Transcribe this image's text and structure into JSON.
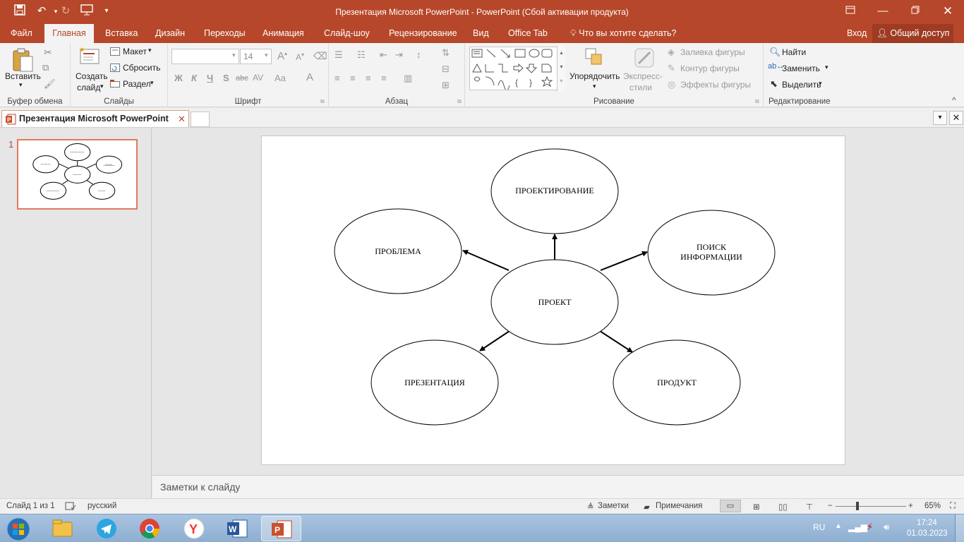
{
  "window": {
    "title": "Презентация Microsoft PowerPoint - PowerPoint (Сбой активации продукта)",
    "sign_in": "Вход",
    "share": "Общий доступ"
  },
  "tabs": [
    "Файл",
    "Главная",
    "Вставка",
    "Дизайн",
    "Переходы",
    "Анимация",
    "Слайд-шоу",
    "Рецензирование",
    "Вид",
    "Office Tab"
  ],
  "tell_me": "Что вы хотите сделать?",
  "ribbon": {
    "clipboard": {
      "paste": "Вставить",
      "label": "Буфер обмена"
    },
    "slides": {
      "new_slide_1": "Создать",
      "new_slide_2": "слайд",
      "layout": "Макет",
      "reset": "Сбросить",
      "section": "Раздел",
      "label": "Слайды"
    },
    "font": {
      "font_size": "14",
      "label": "Шрифт",
      "bold": "Ж",
      "italic": "К",
      "underline": "Ч",
      "shadow": "S",
      "strike": "abc",
      "spacing": "AV",
      "case": "Aa",
      "color": "A"
    },
    "paragraph": {
      "label": "Абзац"
    },
    "drawing": {
      "arrange": "Упорядочить",
      "quick_styles_1": "Экспресс-",
      "quick_styles_2": "стили",
      "fill": "Заливка фигуры",
      "outline": "Контур фигуры",
      "effects": "Эффекты фигуры",
      "label": "Рисование"
    },
    "editing": {
      "find": "Найти",
      "replace": "Заменить",
      "select": "Выделить",
      "label": "Редактирование"
    }
  },
  "document_tab": {
    "label": "Презентация Microsoft PowerPoint"
  },
  "slide_panel": {
    "slide_number": "1"
  },
  "slide": {
    "nodes": {
      "center": "ПРОЕКТ",
      "top": "ПРОЕКТИРОВАНИЕ",
      "left": "ПРОБЛЕМА",
      "right_line1": "ПОИСК",
      "right_line2": "ИНФОРМАЦИИ",
      "bottom_left": "ПРЕЗЕНТАЦИЯ",
      "bottom_right": "ПРОДУКТ"
    }
  },
  "notes_placeholder": "Заметки к слайду",
  "status": {
    "slide_of": "Слайд 1 из 1",
    "language": "русский",
    "notes": "Заметки",
    "comments": "Примечания",
    "zoom": "65%"
  },
  "taskbar": {
    "lang": "RU",
    "time": "17:24",
    "date": "01.03.2023"
  },
  "colors": {
    "accent": "#b7472a",
    "thumb_border": "#e07a5f"
  }
}
